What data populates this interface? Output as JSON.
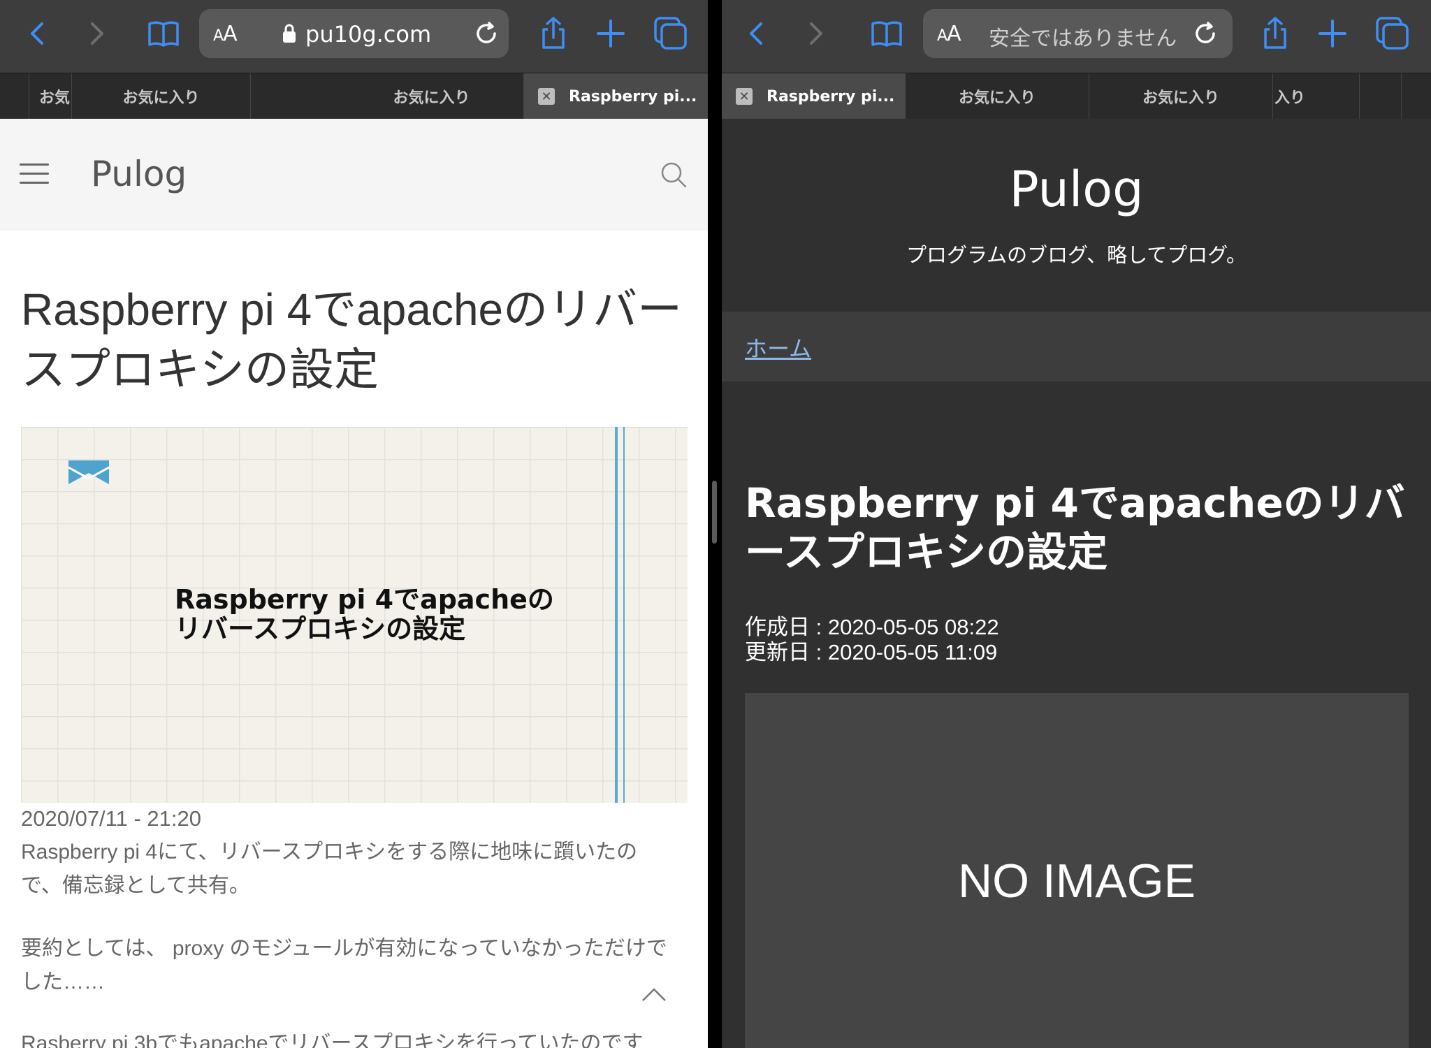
{
  "colors": {
    "accent": "#3f8ef5",
    "toolbar": "#3d3d3d",
    "tabbar": "#2a2a2a",
    "link_right": "#8fb8e8",
    "hero_line": "#5aaad0"
  },
  "left": {
    "address": {
      "aa": "AA",
      "text": "pu10g.com",
      "secure_icon": "lock-icon"
    },
    "tabs": [
      {
        "label": "お気"
      },
      {
        "label": "お気に入り"
      },
      {
        "label": "お気に入り"
      },
      {
        "label": "Raspberry pi..."
      }
    ],
    "site_title": "Pulog",
    "article_title": "Raspberry pi 4でapacheのリバースプロキシの設定",
    "hero_text_line1": "Raspberry pi 4でapacheの",
    "hero_text_line2": "リバースプロキシの設定",
    "date": "2020/07/11 - 21:20",
    "paragraphs": [
      "Raspberry pi 4にて、リバースプロキシをする際に地味に躓いたので、備忘録として共有。",
      "要約としては、 proxy のモジュールが有効になっていなかっただけでした……",
      "Rasberry pi 3bでもapacheでリバースプロキシを行っていたのです"
    ]
  },
  "right": {
    "address": {
      "aa": "AA",
      "text": "安全ではありません"
    },
    "tabs": [
      {
        "label": "Raspberry pi..."
      },
      {
        "label": "お気に入り"
      },
      {
        "label": "お気に入り"
      },
      {
        "label": "入り"
      }
    ],
    "site_title": "Pulog",
    "tagline": "プログラムのブログ、略してプログ。",
    "breadcrumb_home": "ホーム",
    "article_title": "Raspberry pi 4でapacheのリバースプロキシの設定",
    "created": "作成日 : 2020-05-05 08:22",
    "updated": "更新日 : 2020-05-05 11:09",
    "no_image": "NO IMAGE"
  }
}
